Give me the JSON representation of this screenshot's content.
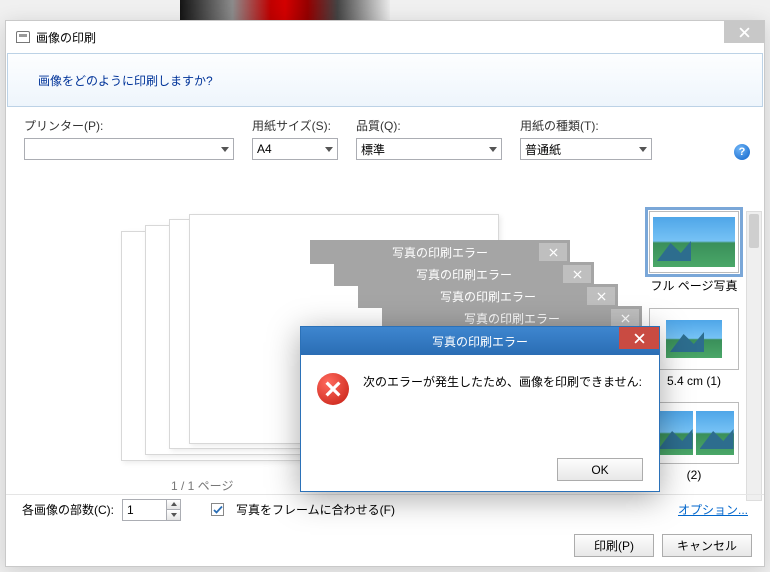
{
  "window": {
    "title": "画像の印刷"
  },
  "banner": {
    "question": "画像をどのように印刷しますか?"
  },
  "options": {
    "printer": {
      "label": "プリンター(P):",
      "value": ""
    },
    "paper_size": {
      "label": "用紙サイズ(S):",
      "value": "A4"
    },
    "quality": {
      "label": "品質(Q):",
      "value": "標準"
    },
    "paper_type": {
      "label": "用紙の種類(T):",
      "value": "普通紙"
    }
  },
  "preview": {
    "page_indicator": "1 / 1 ページ"
  },
  "layouts": {
    "full_page": "フル ページ写真",
    "size_label": "5.4 cm (1)",
    "two_label": "(2)"
  },
  "bottom": {
    "copies_label": "各画像の部数(C):",
    "copies_value": "1",
    "fit_frame": "写真をフレームに合わせる(F)",
    "options_link": "オプション..."
  },
  "actions": {
    "print": "印刷(P)",
    "cancel": "キャンセル"
  },
  "error": {
    "title": "写真の印刷エラー",
    "message": "次のエラーが発生したため、画像を印刷できません:",
    "ok": "OK"
  }
}
